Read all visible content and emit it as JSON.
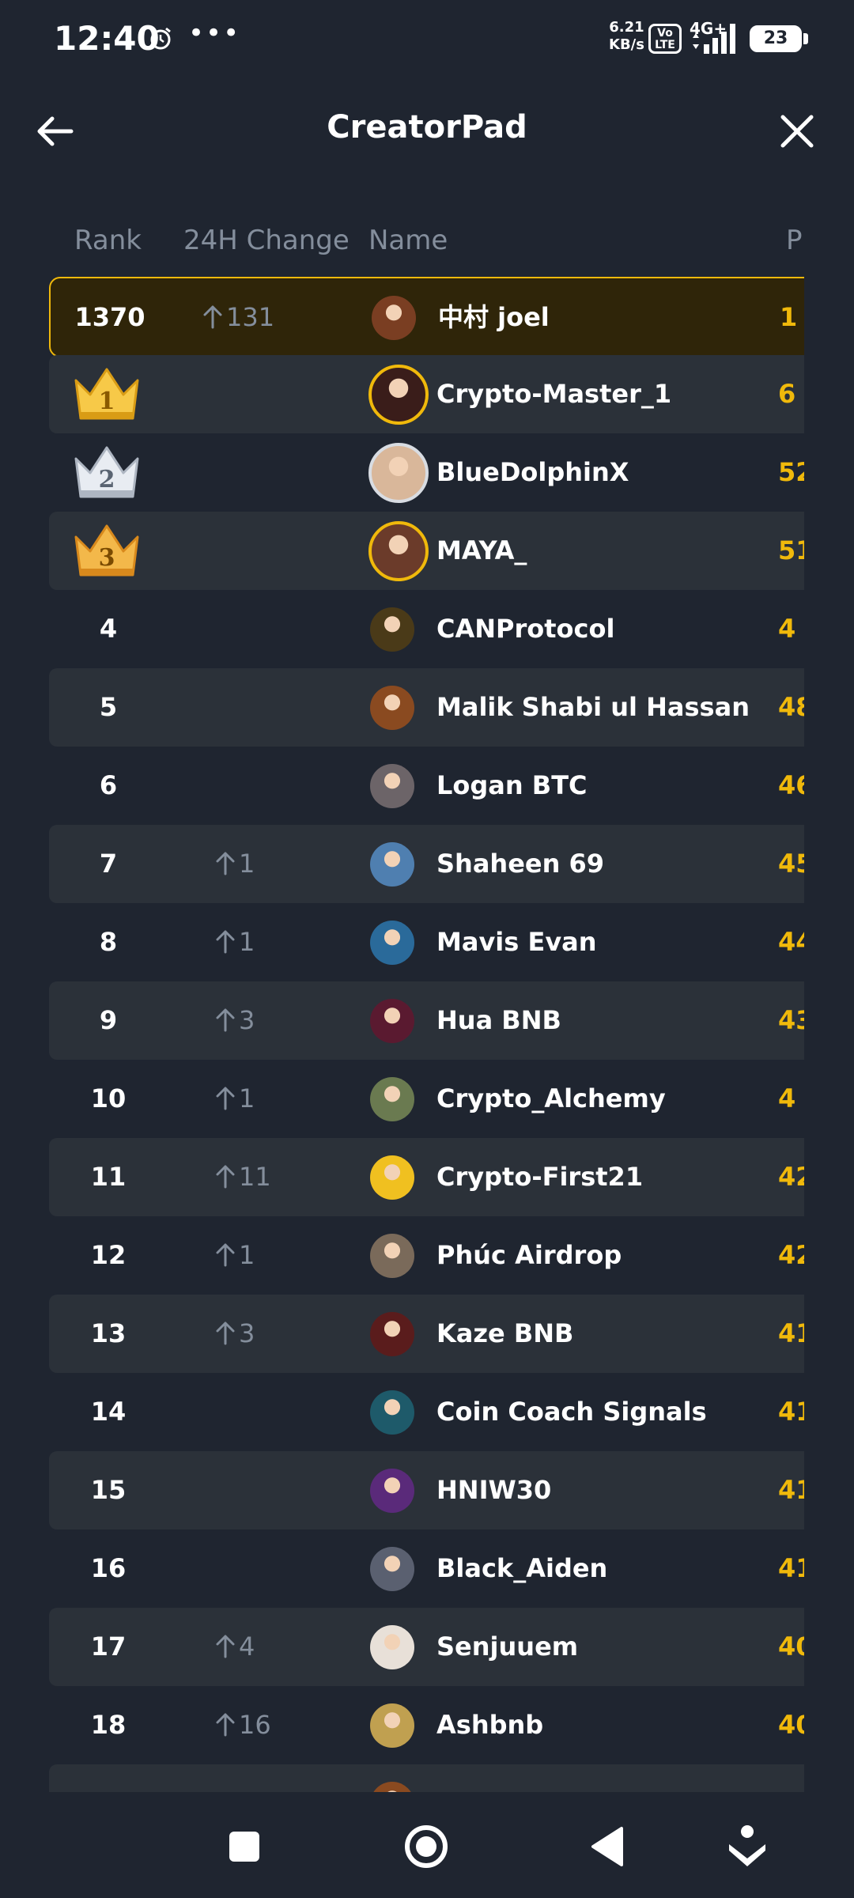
{
  "status_bar": {
    "time": "12:40",
    "speed_value": "6.21",
    "speed_unit": "KB/s",
    "volte_top": "Vo",
    "volte_bottom": "LTE",
    "network": "4G+",
    "battery": "23"
  },
  "header": {
    "title": "CreatorPad"
  },
  "table": {
    "columns": {
      "rank": "Rank",
      "change": "24H Change",
      "name": "Name",
      "points": "P"
    },
    "rows": [
      {
        "rank": "1370",
        "change": "131",
        "name": "中村 joel",
        "points": "1",
        "mine": true,
        "avatar": "#7a3e22"
      },
      {
        "rank": "1",
        "change": "",
        "name": "Crypto-Master_1",
        "points": "6",
        "crown": "gold",
        "avatar": "#3a1d1a"
      },
      {
        "rank": "2",
        "change": "",
        "name": "BlueDolphinX",
        "points": "52",
        "crown": "silver",
        "avatar": "#d9b79a"
      },
      {
        "rank": "3",
        "change": "",
        "name": "MAYA_",
        "points": "51",
        "crown": "bronze",
        "avatar": "#6b3b2a"
      },
      {
        "rank": "4",
        "change": "",
        "name": "CANProtocol",
        "points": "4",
        "avatar": "#4a3a18"
      },
      {
        "rank": "5",
        "change": "",
        "name": "Malik Shabi ul Hassan",
        "points": "48",
        "avatar": "#8a4a20"
      },
      {
        "rank": "6",
        "change": "",
        "name": "Logan BTC",
        "points": "46",
        "avatar": "#6c6468"
      },
      {
        "rank": "7",
        "change": "1",
        "name": "Shaheen 69",
        "points": "45",
        "avatar": "#4f7fb0"
      },
      {
        "rank": "8",
        "change": "1",
        "name": "Mavis Evan",
        "points": "44",
        "avatar": "#2a6a9a"
      },
      {
        "rank": "9",
        "change": "3",
        "name": "Hua BNB",
        "points": "43",
        "avatar": "#5a1a30"
      },
      {
        "rank": "10",
        "change": "1",
        "name": "Crypto_Alchemy",
        "points": "4",
        "avatar": "#6a7a50"
      },
      {
        "rank": "11",
        "change": "11",
        "name": "Crypto-First21",
        "points": "42",
        "avatar": "#f0c020"
      },
      {
        "rank": "12",
        "change": "1",
        "name": "Phúc Airdrop",
        "points": "42",
        "avatar": "#7a6a5a"
      },
      {
        "rank": "13",
        "change": "3",
        "name": "Kaze BNB",
        "points": "41",
        "avatar": "#5a1c1c"
      },
      {
        "rank": "14",
        "change": "",
        "name": "Coin Coach Signals",
        "points": "41",
        "avatar": "#1e5a6a"
      },
      {
        "rank": "15",
        "change": "",
        "name": "HNIW30",
        "points": "41",
        "avatar": "#5a2a7a"
      },
      {
        "rank": "16",
        "change": "",
        "name": "Black_Aiden",
        "points": "41",
        "avatar": "#5a6070"
      },
      {
        "rank": "17",
        "change": "4",
        "name": "Senjuuem",
        "points": "40",
        "avatar": "#e8e0d8"
      },
      {
        "rank": "18",
        "change": "16",
        "name": "Ashbnb",
        "points": "40",
        "avatar": "#c0a050"
      },
      {
        "rank": "",
        "change": "",
        "name": "",
        "points": "",
        "avatar": "#8a4a20"
      }
    ]
  },
  "nav": {
    "recents_icon": "square-icon",
    "home_icon": "circle-icon",
    "back_icon": "triangle-back-icon",
    "assist_icon": "accessibility-icon"
  },
  "colors": {
    "background": "#1f2530",
    "row_alt": "#2b3139",
    "accent": "#f0b90b",
    "muted": "#848e9c"
  }
}
